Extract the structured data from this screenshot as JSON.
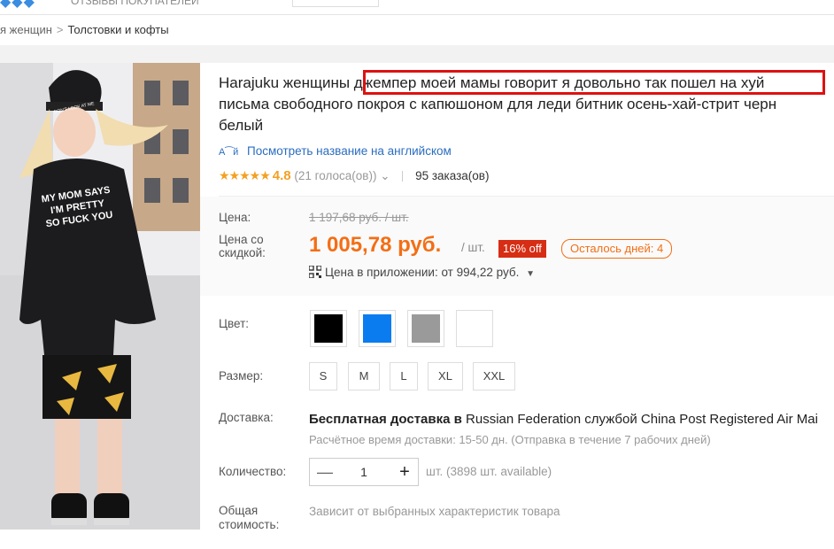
{
  "topbar": {
    "text": "ОТЗЫВЫ ПОКУПАТЕЛЕЙ",
    "box_label": ""
  },
  "breadcrumb": {
    "partial": "я женщин",
    "separator": ">",
    "current": "Толстовки и кофты"
  },
  "product": {
    "title_line1": "Harajuku женщины джемпер моей мамы говорит я довольно так пошел на хуй",
    "title_line2": "письма свободного покроя с капюшоном для леди битник осень-хай-стрит черн",
    "title_line3": "белый",
    "image_shirt_text": [
      "MY MOM SAYS",
      "I'M PRETTY",
      "SO FUCK YOU"
    ],
    "image_hat_text": "DON'T LOOK AT ME",
    "translate_icon": "translate-icon",
    "translate_label": "Посмотреть название на английском",
    "rating_score": "4.8",
    "rating_votes": "(21 голоса(ов))",
    "orders": "95 заказа(ов)"
  },
  "price": {
    "label": "Цена:",
    "old": "1 197,68 руб. / шт.",
    "discount_label_1": "Цена со",
    "discount_label_2": "скидкой:",
    "new": "1 005,78 руб.",
    "unit": "/ шт.",
    "off_badge": "16% off",
    "days_left": "Осталось дней: 4",
    "app_price": "Цена в приложении: от 994,22 руб."
  },
  "options": {
    "color_label": "Цвет:",
    "colors": [
      "#000000",
      "#0a7cf0",
      "#9a9a9a",
      "#ffffff"
    ],
    "size_label": "Размер:",
    "sizes": [
      "S",
      "M",
      "L",
      "XL",
      "XXL"
    ]
  },
  "shipping": {
    "label": "Доставка:",
    "main_bold": "Бесплатная доставка в",
    "main_rest": "Russian Federation службой China Post Registered Air Mai",
    "sub": "Расчётное время доставки: 15-50 дн. (Отправка в течение 7 рабочих дней)"
  },
  "quantity": {
    "label": "Количество:",
    "minus": "—",
    "value": "1",
    "plus": "+",
    "info": "шт. (3898 шт. available)"
  },
  "total": {
    "label_1": "Общая",
    "label_2": "стоимость:",
    "note": "Зависит от выбранных характеристик товара"
  }
}
